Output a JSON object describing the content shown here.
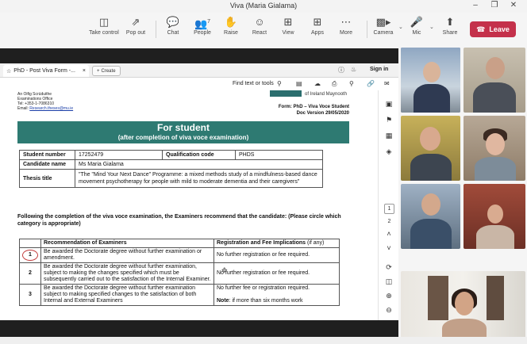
{
  "window": {
    "title": "Viva (Maria Gialama)",
    "minimize_icon": "minimize-icon",
    "restore_icon": "restore-icon",
    "close_icon": "close-icon"
  },
  "toolbar": {
    "take_control": "Take control",
    "pop_out": "Pop out",
    "chat": "Chat",
    "people": "People",
    "people_count": "7",
    "raise": "Raise",
    "react": "React",
    "view": "View",
    "apps": "Apps",
    "more": "More",
    "camera": "Camera",
    "mic": "Mic",
    "share": "Share",
    "leave": "Leave",
    "leave_color": "#c4314b"
  },
  "pdf": {
    "tab_title": "PhD - Post Viva Form -...",
    "create": "Create",
    "sign_in": "Sign in",
    "find_text": "Find text or tools",
    "page_current": "1",
    "page_next": "2",
    "header": {
      "line1": "An Oifig Scrúduithe",
      "line2": "Examinations Office",
      "tel": "Tel:   +353-1-7086310",
      "email_label": "Email:",
      "email_link": "Research.theses@mu.ie",
      "logo_text": "of Ireland Maynooth",
      "form_title": "Form: PhD – Viva Voce Student",
      "doc_version": "Doc Version 29/05/2020"
    },
    "banner": {
      "title": "For student",
      "subtitle": "(after completion of viva voce examination)"
    },
    "info": {
      "student_number_label": "Student number",
      "student_number": "17252479",
      "qualification_label": "Qualification code",
      "qualification_code": "PHDS",
      "candidate_label": "Candidate name",
      "candidate_name": "Ms Maria Gialama",
      "thesis_label": "Thesis title",
      "thesis_title": "\"The \"Mind Your Next Dance\" Programme: a mixed methods study of a mindfulness-based dance movement psychotherapy for people with mild to moderate dementia and their caregivers\""
    },
    "recommend_text": "Following the completion of the viva voce examination, the Examiners recommend that the candidate: (Please circle which category is appropriate)",
    "rec_table": {
      "col1": "Recommendation of Examiners",
      "col2_bold": "Registration and Fee Implications",
      "col2_note": " (if any)",
      "rows": [
        {
          "num": "1",
          "rec": "Be awarded the Doctorate degree without further examination or amendment.",
          "fee": "No further registration or fee required."
        },
        {
          "num": "2",
          "rec": "Be awarded the Doctorate degree without further examination, subject to making the changes specified which must be subsequently carried out to the satisfaction of the Internal Examiner.",
          "fee": "No further registration or fee required."
        },
        {
          "num": "3",
          "rec": "Be awarded the Doctorate degree without further examination subject to making specified changes to the satisfaction of both Internal and External Examiners",
          "fee": "No further fee or registration required.",
          "fee_note_bold": "Note",
          "fee_note": ": if more than six months work"
        }
      ]
    }
  },
  "colors": {
    "banner": "#2e7a72",
    "active_speaker": "#6264a7",
    "circle_mark": "#c23b3b"
  }
}
